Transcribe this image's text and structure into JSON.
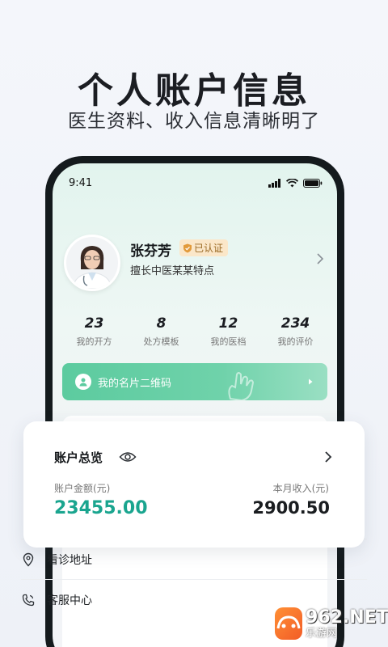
{
  "promo": {
    "headline": "个人账户信息",
    "subline": "医生资料、收入信息清晰明了"
  },
  "status_bar": {
    "time": "9:41",
    "icons": [
      "signal-icon",
      "wifi-icon",
      "battery-icon"
    ]
  },
  "profile": {
    "name": "张芬芳",
    "verified_badge": "已认证",
    "specialty": "擅长中医某某特点"
  },
  "stats": [
    {
      "value": "23",
      "label": "我的开方"
    },
    {
      "value": "8",
      "label": "处方模板"
    },
    {
      "value": "12",
      "label": "我的医档"
    },
    {
      "value": "234",
      "label": "我的评价"
    }
  ],
  "qr_card": {
    "label": "我的名片二维码"
  },
  "account_overview": {
    "title": "账户总览",
    "balance_label": "账户金额(元)",
    "balance_value": "23455.00",
    "monthly_income_label": "本月收入(元)",
    "monthly_income_value": "2900.50"
  },
  "menu": [
    {
      "label": "看诊地址",
      "icon": "location-pin-icon"
    },
    {
      "label": "客服中心",
      "icon": "phone-service-icon"
    }
  ],
  "watermark": {
    "brand": "962.NET",
    "sub": "乐游网"
  },
  "colors": {
    "accent": "#5ccb9f",
    "balance": "#1aa58f",
    "badge_bg": "#fbe7c9"
  }
}
